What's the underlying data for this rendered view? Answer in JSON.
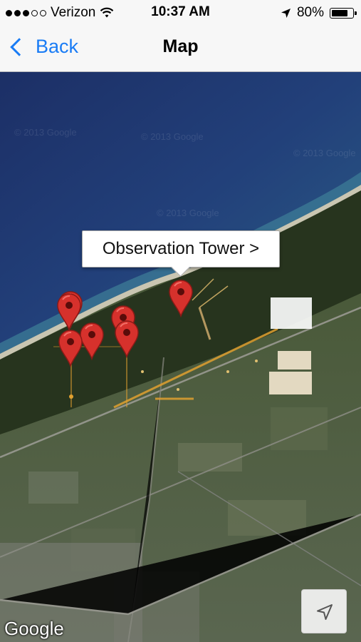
{
  "status_bar": {
    "carrier": "Verizon",
    "signal_bars_filled": 3,
    "signal_bars_total": 5,
    "time": "10:37 AM",
    "battery": "80%",
    "battery_level": 0.8,
    "icons": [
      "wifi-icon",
      "location-arrow-icon",
      "battery-icon"
    ]
  },
  "nav": {
    "back_label": "Back",
    "title": "Map"
  },
  "map": {
    "callout_label": "Observation Tower >",
    "watermark": "© 2013 Google",
    "attribution": "Google",
    "pins_count": 7,
    "locate_button_icon": "location-arrow-icon"
  },
  "colors": {
    "accent": "#1a7cf5",
    "pin": "#d6312c",
    "bar": "#f7f7f7"
  }
}
